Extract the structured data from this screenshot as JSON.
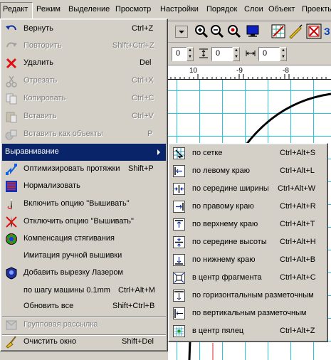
{
  "menubar": {
    "items": [
      "Редакт",
      "Режим",
      "Выделение",
      "Просмотр",
      "Настройки",
      "Порядок",
      "Слои",
      "Объект",
      "Проекты"
    ]
  },
  "toolbar": {
    "field1": "0",
    "field2": "0",
    "field3": "0"
  },
  "ruler": {
    "labels": [
      "10",
      "-9",
      "-8"
    ]
  },
  "main_menu": {
    "items": [
      {
        "label": "Вернуть",
        "shortcut": "Ctrl+Z",
        "icon": "undo-icon",
        "disabled": false
      },
      {
        "label": "Повторить",
        "shortcut": "Shift+Ctrl+Z",
        "icon": "redo-icon",
        "disabled": true
      },
      {
        "label": "Удалить",
        "shortcut": "Del",
        "icon": "delete-icon",
        "disabled": false
      },
      {
        "label": "Отрезать",
        "shortcut": "Ctrl+X",
        "icon": "cut-icon",
        "disabled": true
      },
      {
        "label": "Копировать",
        "shortcut": "Ctrl+C",
        "icon": "copy-icon",
        "disabled": true
      },
      {
        "label": "Вставить",
        "shortcut": "Ctrl+V",
        "icon": "paste-icon",
        "disabled": true
      },
      {
        "label": "Вставить как объекты",
        "shortcut": "P",
        "icon": "paste-as-objects-icon",
        "disabled": true
      },
      {
        "label": "Выравнивание",
        "shortcut": "",
        "icon": "",
        "disabled": false
      },
      {
        "label": "Оптимизировать протяжки",
        "shortcut": "Shift+P",
        "icon": "optimize-jumps-icon",
        "disabled": false
      },
      {
        "label": "Нормализовать",
        "shortcut": "",
        "icon": "normalize-icon",
        "disabled": false
      },
      {
        "label": "Включить опцию \"Вышивать\"",
        "shortcut": "",
        "icon": "needle-on-icon",
        "disabled": false
      },
      {
        "label": "Отключить опцию \"Вышивать\"",
        "shortcut": "",
        "icon": "needle-off-icon",
        "disabled": false
      },
      {
        "label": "Компенсация стягивания",
        "shortcut": "",
        "icon": "pull-compensation-icon",
        "disabled": false
      },
      {
        "label": "Имитация ручной вышивки",
        "shortcut": "",
        "icon": "",
        "disabled": false
      },
      {
        "label": "Добавить вырезку Лазером",
        "shortcut": "",
        "icon": "laser-cut-icon",
        "disabled": false
      },
      {
        "label": "по шагу машины 0.1mm",
        "shortcut": "Ctrl+Alt+M",
        "icon": "",
        "disabled": false
      },
      {
        "label": "Обновить все",
        "shortcut": "Shift+Ctrl+B",
        "icon": "",
        "disabled": false
      },
      {
        "label": "Групповая рассылка",
        "shortcut": "",
        "icon": "group-mailing-icon",
        "disabled": true
      },
      {
        "label": "Очистить окно",
        "shortcut": "Shift+Del",
        "icon": "broom-icon",
        "disabled": false
      }
    ]
  },
  "align_submenu": {
    "items": [
      {
        "label": "по сетке",
        "shortcut": "Ctrl+Alt+S",
        "icon": "align-grid-icon"
      },
      {
        "label": "по левому краю",
        "shortcut": "Ctrl+Alt+L",
        "icon": "align-left-icon"
      },
      {
        "label": "по середине ширины",
        "shortcut": "Ctrl+Alt+W",
        "icon": "align-center-width-icon"
      },
      {
        "label": "по правому краю",
        "shortcut": "Ctrl+Alt+R",
        "icon": "align-right-icon"
      },
      {
        "label": "по верхнему краю",
        "shortcut": "Ctrl+Alt+T",
        "icon": "align-top-icon"
      },
      {
        "label": "по середине высоты",
        "shortcut": "Ctrl+Alt+H",
        "icon": "align-center-height-icon"
      },
      {
        "label": "по нижнему краю",
        "shortcut": "Ctrl+Alt+B",
        "icon": "align-bottom-icon"
      },
      {
        "label": "в центр фрагмента",
        "shortcut": "Ctrl+Alt+C",
        "icon": "align-fragment-center-icon"
      },
      {
        "label": "по горизонтальным разметочным",
        "shortcut": "",
        "icon": "align-horizontal-guides-icon"
      },
      {
        "label": "по вертикальным разметочным",
        "shortcut": "",
        "icon": "align-vertical-guides-icon"
      },
      {
        "label": "в центр пялец",
        "shortcut": "Ctrl+Alt+Z",
        "icon": "align-hoop-center-icon"
      }
    ]
  },
  "colors": {
    "selection": "#0a246a",
    "grid": "#29c6e0",
    "menu_bg": "#d4d0c8"
  }
}
